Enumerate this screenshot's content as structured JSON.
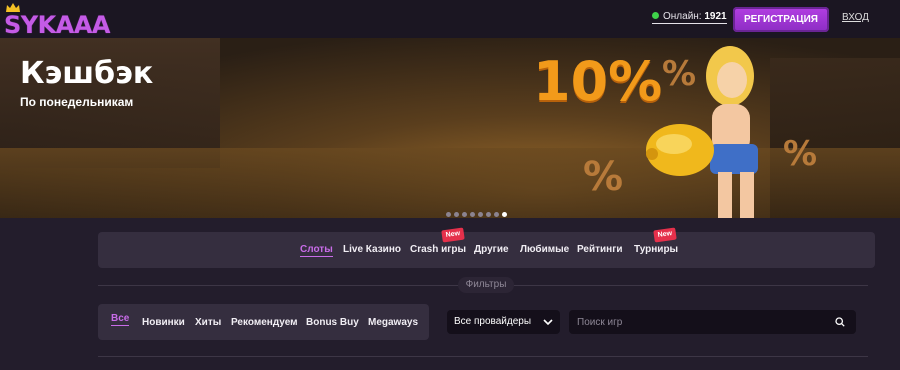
{
  "header": {
    "logo_text": "SYKAAA",
    "online_label": "Онлайн:",
    "online_count": "1921",
    "register_label": "РЕГИСТРАЦИЯ",
    "login_label": "ВХОД"
  },
  "banner": {
    "title": "Кэшбэк",
    "subtitle": "По понедельникам",
    "percent_big": "10%",
    "percent_small": "%",
    "slides_total": 8,
    "active_slide": 8
  },
  "categories": [
    {
      "label": "Слоты",
      "active": true
    },
    {
      "label": "Live Казино"
    },
    {
      "label": "Crash игры",
      "badge": "New"
    },
    {
      "label": "Другие"
    },
    {
      "label": "Любимые"
    },
    {
      "label": "Рейтинги"
    },
    {
      "label": "Турниры",
      "badge": "New"
    }
  ],
  "filters": {
    "label": "Фильтры",
    "tabs": [
      {
        "label": "Все",
        "active": true
      },
      {
        "label": "Новинки"
      },
      {
        "label": "Хиты"
      },
      {
        "label": "Рекомендуем"
      },
      {
        "label": "Bonus Buy"
      },
      {
        "label": "Megaways"
      }
    ],
    "provider_select": "Все провайдеры",
    "search_placeholder": "Поиск игр"
  },
  "colors": {
    "accent": "#c86ce8",
    "register_button": "#a236d6",
    "online_dot": "#3fd24a",
    "new_badge": "#e5304b"
  },
  "icons": {
    "logo_crown": "crown-icon",
    "provider_select": "chevron-down-icon",
    "search": "search-icon"
  }
}
